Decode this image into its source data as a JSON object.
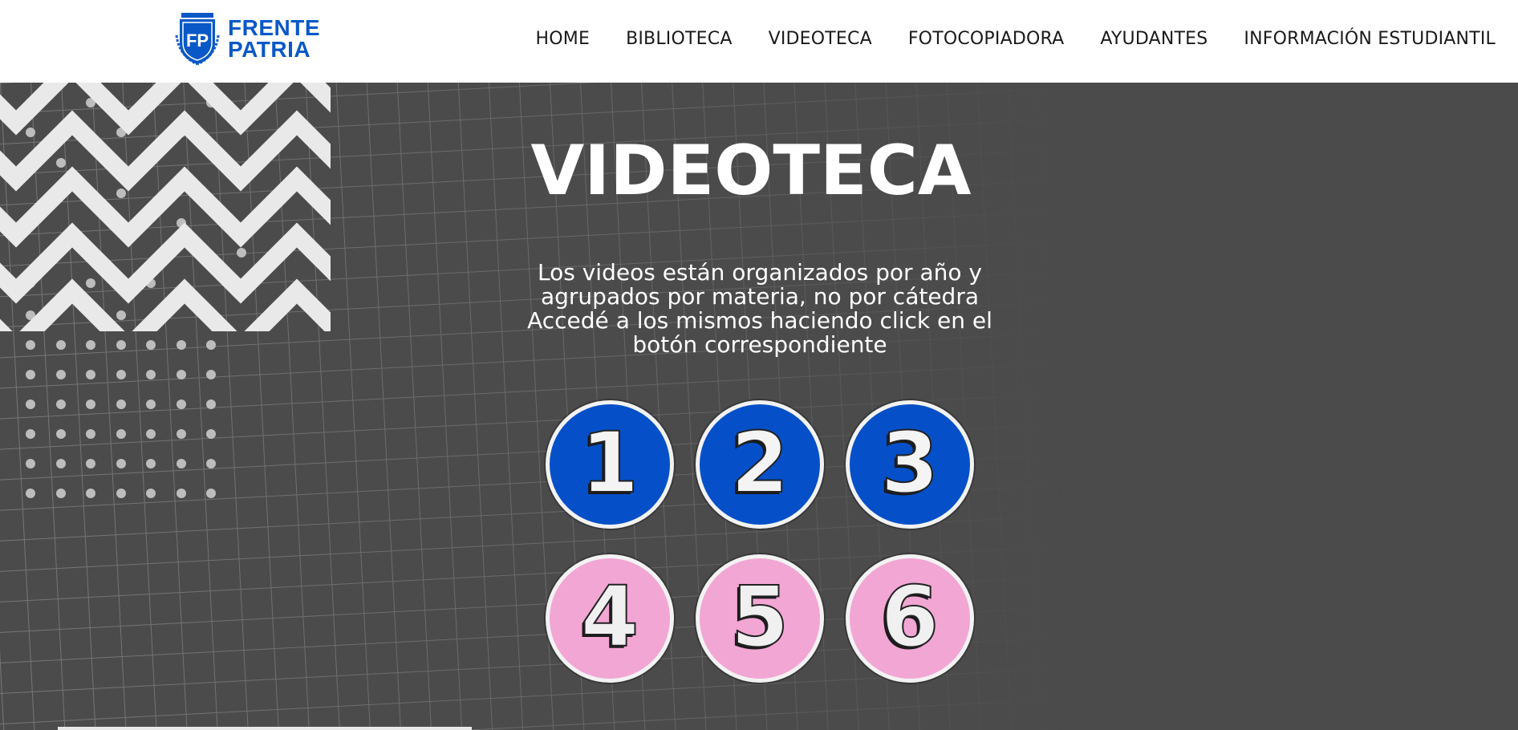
{
  "brand": {
    "line1": "FRENTE",
    "line2": "PATRIA",
    "emblem_letters": "FP",
    "color": "#0a58c8"
  },
  "nav": {
    "items": [
      {
        "label": "HOME"
      },
      {
        "label": "BIBLIOTECA"
      },
      {
        "label": "VIDEOTECA"
      },
      {
        "label": "FOTOCOPIADORA"
      },
      {
        "label": "AYUDANTES"
      },
      {
        "label": "INFORMACIÓN ESTUDIANTIL"
      }
    ]
  },
  "hero": {
    "title": "VIDEOTECA",
    "description": [
      "Los videos están organizados por año y",
      "agrupados por materia, no por cátedra",
      "Accedé a los mismos haciendo click en el",
      "botón correspondiente"
    ]
  },
  "year_buttons": [
    {
      "label": "1",
      "color": "#0550c8"
    },
    {
      "label": "2",
      "color": "#0550c8"
    },
    {
      "label": "3",
      "color": "#0550c8"
    },
    {
      "label": "4",
      "color": "#f2a6d4"
    },
    {
      "label": "5",
      "color": "#f2a6d4"
    },
    {
      "label": "6",
      "color": "#f2a6d4"
    }
  ],
  "colors": {
    "header_bg": "#ffffff",
    "hero_bg": "#4b4b4b",
    "accent_blue": "#0550c8",
    "accent_pink": "#f2a6d4"
  }
}
